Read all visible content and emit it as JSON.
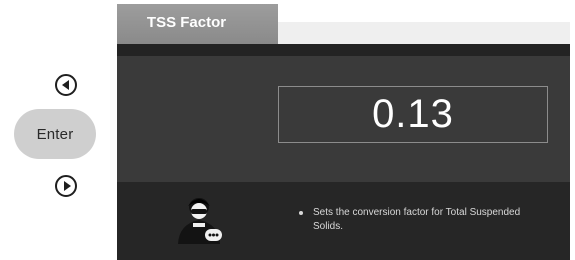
{
  "controls": {
    "enter_label": "Enter",
    "left_icon": "circle-left-arrow-icon",
    "right_icon": "circle-right-arrow-icon"
  },
  "screen": {
    "tab_title": "TSS Factor",
    "value": "0.13",
    "help_text": "Sets the conversion factor for Total Suspended Solids.",
    "help_icon": "operator-avatar-icon"
  },
  "colors": {
    "screen_bg": "#2f2f2f",
    "value_bg": "#3a3a3a",
    "help_bg": "#262626",
    "tab_bg": "#959595",
    "enter_bg": "#cfcfcf"
  }
}
